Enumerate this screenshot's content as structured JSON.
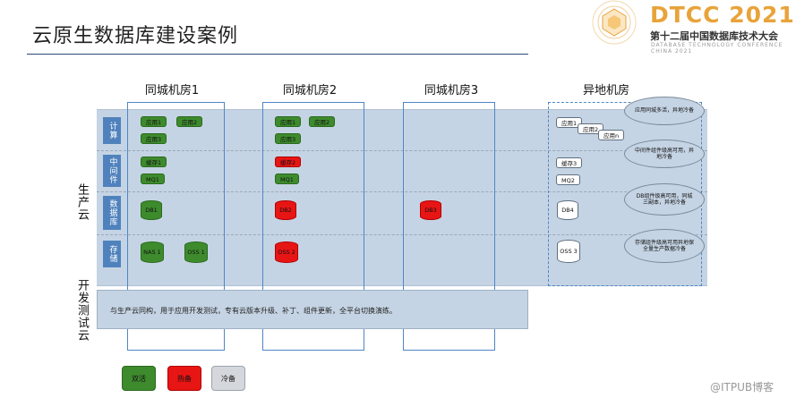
{
  "slide": {
    "title": "云原生数据库建设案例"
  },
  "logo": {
    "name": "DTCC 2021",
    "subtitle": "第十二届中国数据库技术大会",
    "english": "DATABASE TECHNOLOGY CONFERENCE CHINA 2021"
  },
  "columns": [
    "同城机房1",
    "同城机房2",
    "同城机房3",
    "异地机房"
  ],
  "clouds": {
    "production": "生产云",
    "dev_test": "开发测试云"
  },
  "rows": [
    "计算",
    "中间件",
    "数据库",
    "存储"
  ],
  "compute": {
    "dc1": [
      "应用1",
      "应用2",
      "应用3"
    ],
    "dc2": [
      "应用1",
      "应用2",
      "应用3"
    ],
    "remote": [
      "应用1",
      "应用2",
      "应用n"
    ]
  },
  "middleware": {
    "dc1": [
      "缓存1",
      "MQ1"
    ],
    "dc2": [
      "缓存2",
      "MQ1"
    ],
    "remote": [
      "缓存3",
      "MQ2"
    ]
  },
  "databases": {
    "dc1": "DB1",
    "dc2": "DB2",
    "dc3": "DB3",
    "remote": "DB4"
  },
  "storage": {
    "dc1_nas": "NAS 1",
    "dc1_oss": "OSS 1",
    "dc2_oss": "OSS 2",
    "remote_oss": "OSS 3"
  },
  "notes": [
    "应用同城多活，异地冷备",
    "中间件组件级高可用，异地冷备",
    "DB组件级高可用，同城三副本，异地冷备",
    "存储组件级高可用异地保全量生产数据冷备"
  ],
  "dev_text": "与生产云同构，用于应用开发测试，专有云版本升级、补丁、组件更新，全平台切换演练。",
  "legend": [
    "双活",
    "热备",
    "冷备"
  ],
  "watermark": "@ITPUB博客",
  "colors": {
    "active": "#3e8b2e",
    "hot": "#e81515",
    "cold": "#d4d8dc",
    "band": "#c5d4e4",
    "row_label": "#4f82bd",
    "dc_border": "#4f86c6"
  }
}
